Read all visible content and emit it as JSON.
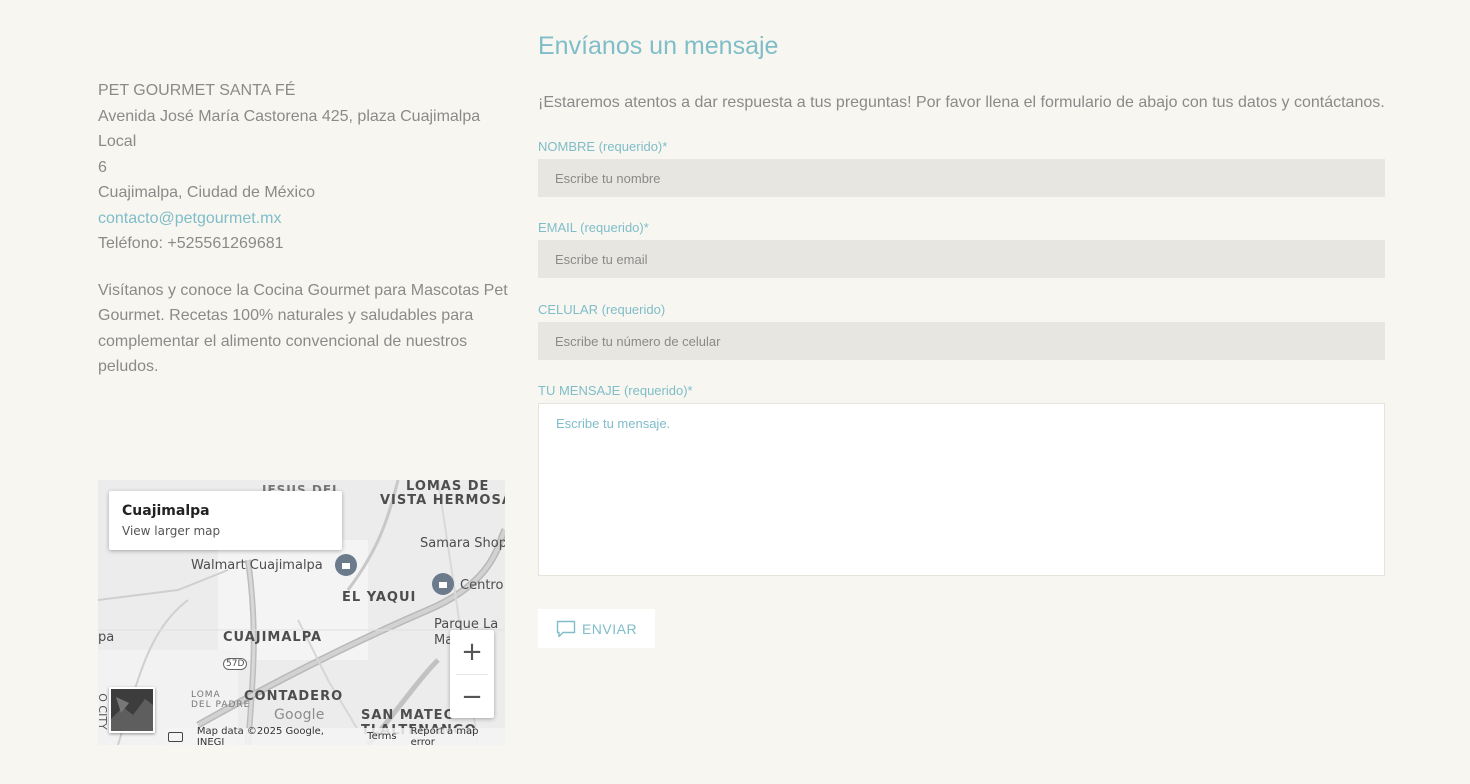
{
  "contact": {
    "name": "PET GOURMET SANTA FÉ",
    "address_line1": "Avenida José María Castorena 425, plaza Cuajimalpa Local",
    "address_line2": "6",
    "city": "Cuajimalpa, Ciudad de México",
    "email": "contacto@petgourmet.mx",
    "phone": "Teléfono: +525561269681",
    "blurb_lines": [
      "Visítanos y conoce la Cocina Gourmet para Mascotas Pet",
      "Gourmet. Recetas 100% naturales y saludables para",
      "complementar el alimento convencional de nuestros peludos."
    ]
  },
  "map": {
    "place_title": "Cuajimalpa",
    "larger_map_link": "View larger map",
    "zoom_in": "+",
    "zoom_out": "−",
    "google_logo": "Google",
    "attribution": "Map data ©2025 Google, INEGI",
    "terms": "Terms",
    "report": "Report a map error",
    "labels": {
      "lomas1": "LOMAS DE",
      "lomas2": "VISTA HERMOSA",
      "jesus": "JESUS DEL",
      "samara": "Samara Shop",
      "walmart": "Walmart Cuajimalpa",
      "centro": "Centro",
      "yaqui": "EL YAQUI",
      "cuajimalpa": "CUAJIMALPA",
      "parque1": "Parque La",
      "parque2": "Ma...",
      "route": "57D",
      "loma1": "LOMA",
      "loma2": "DEL PADRE",
      "contadero": "CONTADERO",
      "sanmateo1": "SAN MATEO",
      "sanmateo2": "TLALTENANGO",
      "pa": "pa",
      "city_vertical": "O CITY"
    },
    "icons": [
      "lock-pin-icon",
      "keyboard-icon",
      "map-layers-thumbnail"
    ]
  },
  "form": {
    "title": "Envíanos un mensaje",
    "intro": "¡Estaremos atentos a dar respuesta a tus preguntas! Por favor llena el formulario de abajo con tus datos y contáctanos.",
    "name_label": "NOMBRE (requerido)*",
    "name_placeholder": "Escribe tu nombre",
    "email_label": "EMAIL (requerido)*",
    "email_placeholder": "Escribe tu email",
    "phone_label": "CELULAR (requerido)",
    "phone_placeholder": "Escribe tu número de celular",
    "message_label": "TU MENSAJE (requerido)*",
    "message_placeholder": "Escribe tu mensaje.",
    "submit_label": "ENVIAR",
    "submit_icon": "chat-bubble-icon"
  },
  "colors": {
    "background": "#f8f6f0",
    "accent": "#7fbdc9",
    "text": "#8a8a8a",
    "field_bg": "#e8e6e0"
  }
}
